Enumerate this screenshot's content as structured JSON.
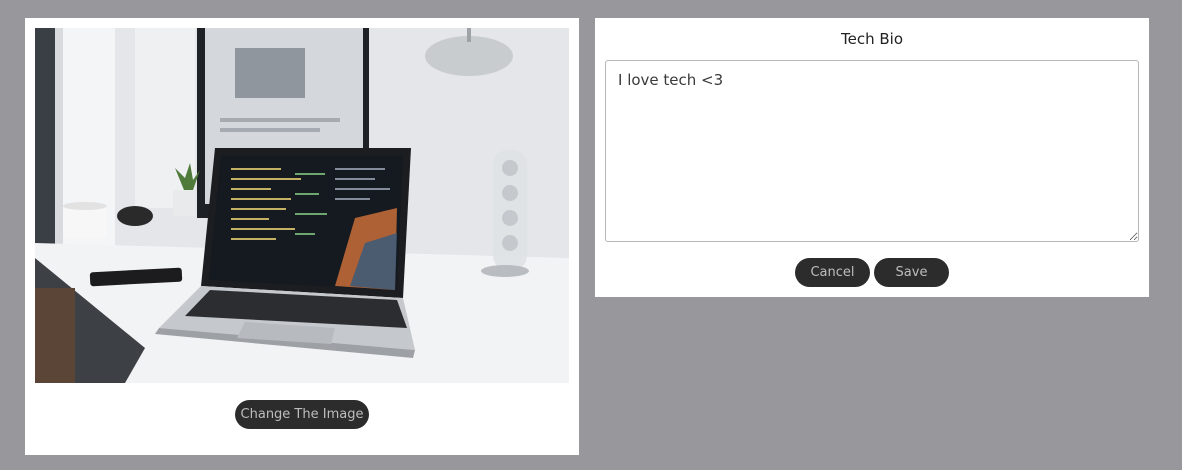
{
  "image_card": {
    "photo_alt": "Laptop with code editor on a white desk",
    "change_button_label": "Change The Image"
  },
  "bio_card": {
    "title": "Tech Bio",
    "bio_text": "I love tech <3",
    "cancel_label": "Cancel",
    "save_label": "Save"
  },
  "colors": {
    "backdrop": "#98979c",
    "card": "#ffffff",
    "button_bg": "#2c2c2c",
    "button_text": "#bdbdbd"
  }
}
